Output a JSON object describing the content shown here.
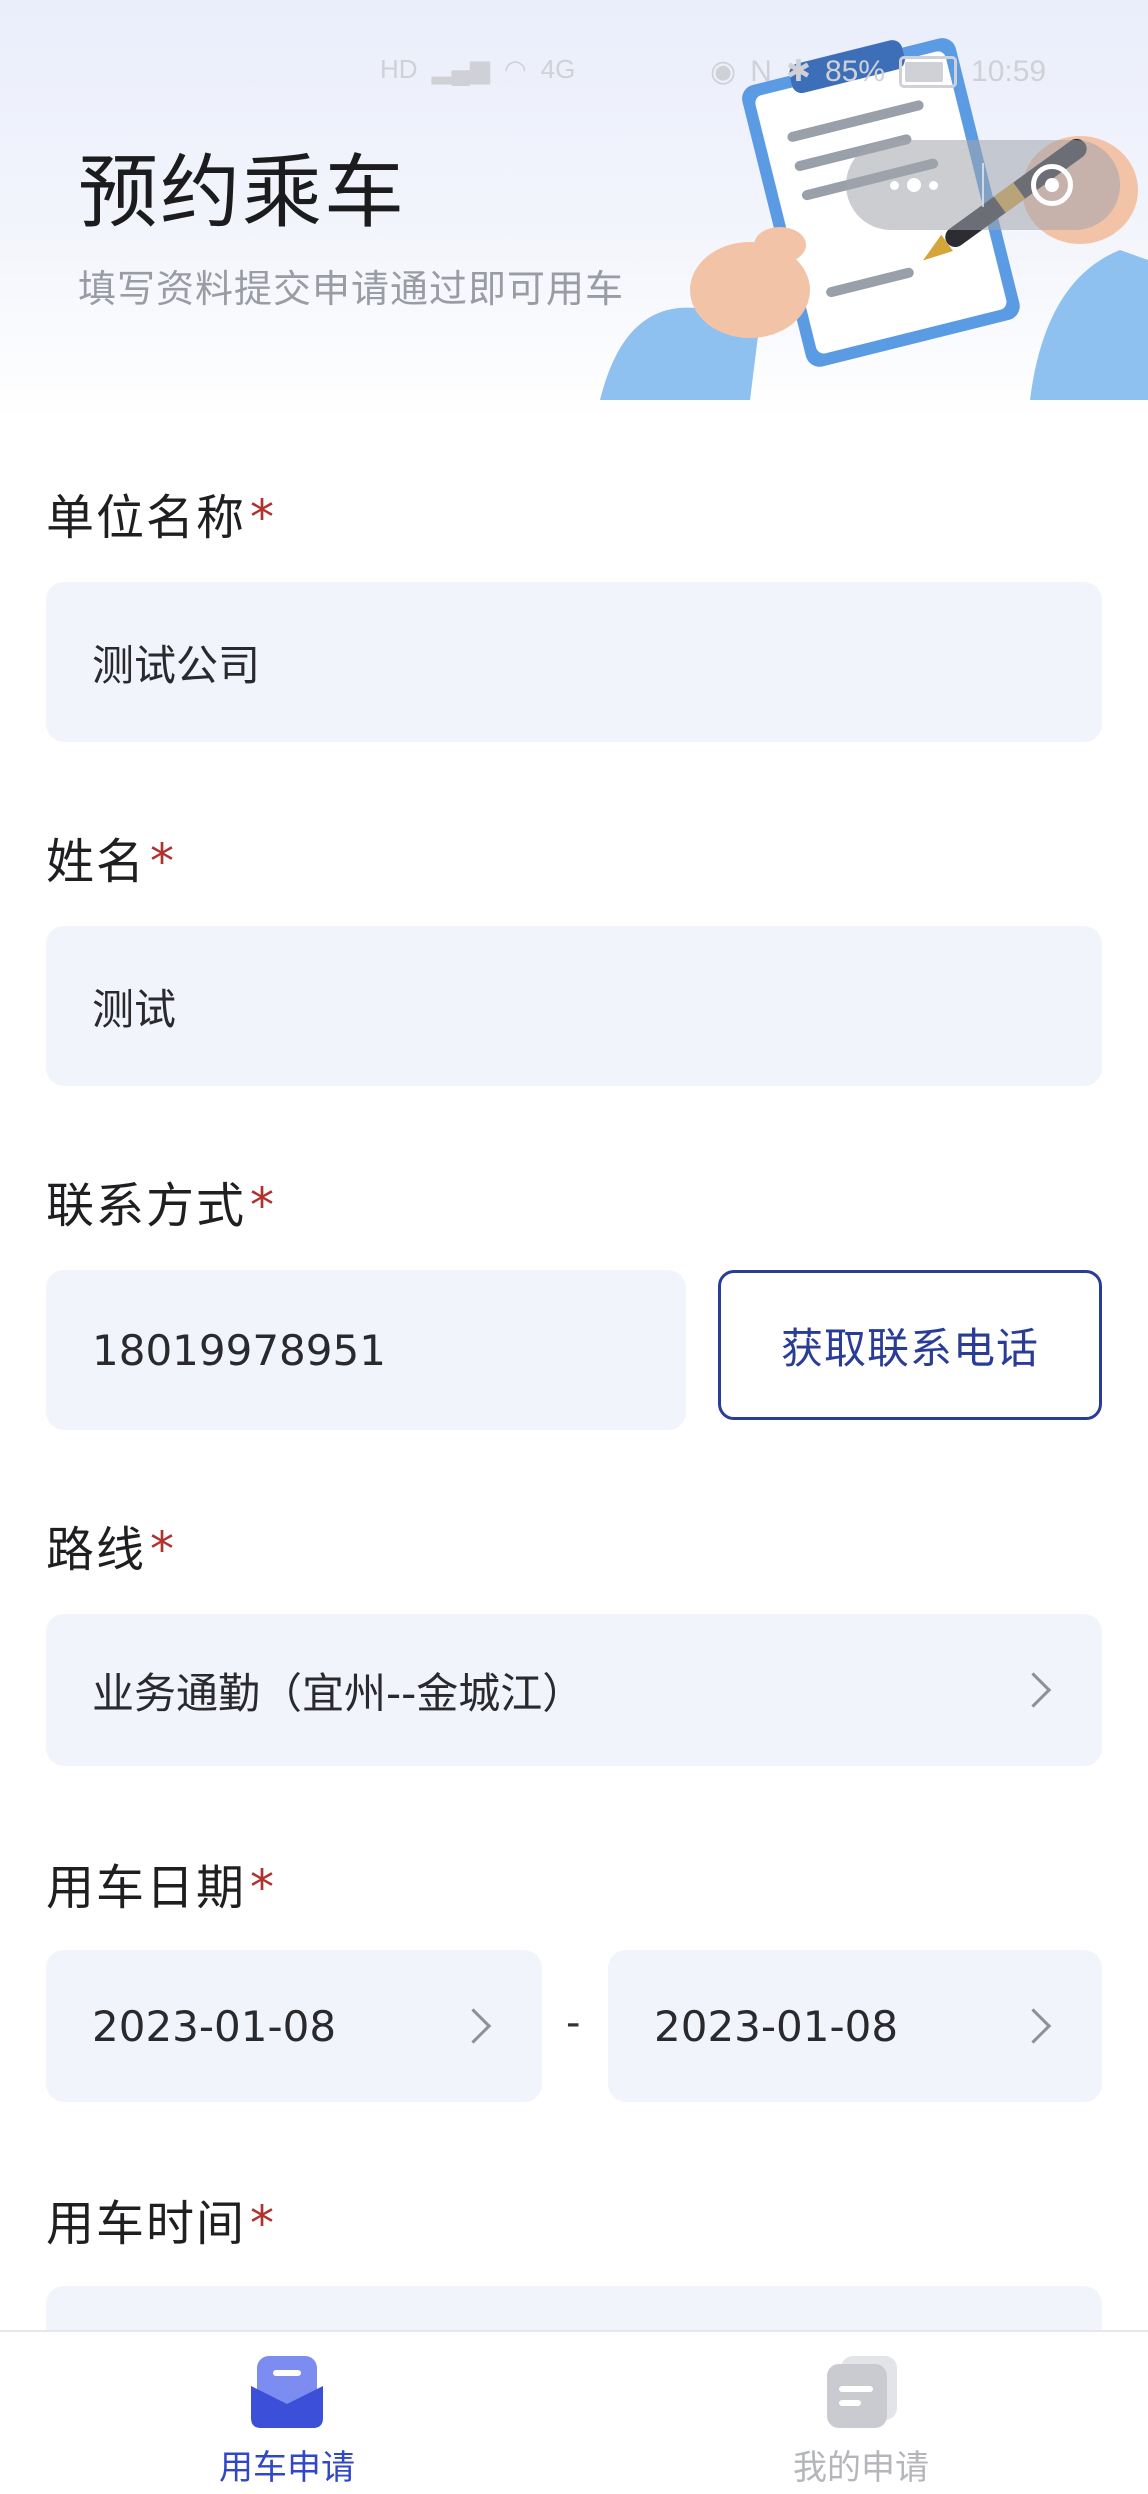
{
  "status_bar": {
    "left_text": "HD",
    "network": "4G",
    "battery_percent": "85%",
    "time": "10:59"
  },
  "header": {
    "title": "预约乘车",
    "subtitle": "填写资料提交申请通过即可用车"
  },
  "form": {
    "company": {
      "label": "单位名称",
      "required_mark": "*",
      "value": "测试公司"
    },
    "name": {
      "label": "姓名",
      "required_mark": "*",
      "value": "测试"
    },
    "contact": {
      "label": "联系方式",
      "required_mark": "*",
      "value": "18019978951",
      "button_label": "获取联系电话"
    },
    "route": {
      "label": "路线",
      "required_mark": "*",
      "value": "业务通勤（宜州--金城江）"
    },
    "date": {
      "label": "用车日期",
      "required_mark": "*",
      "start": "2023-01-08",
      "separator": "-",
      "end": "2023-01-08"
    },
    "time": {
      "label": "用车时间",
      "required_mark": "*",
      "value": ""
    }
  },
  "tabbar": {
    "tabs": [
      {
        "label": "用车申请",
        "active": true,
        "icon": "car-application-icon"
      },
      {
        "label": "我的申请",
        "active": false,
        "icon": "my-applications-icon"
      }
    ]
  },
  "colors": {
    "accent": "#3047c7",
    "required": "#b0312d",
    "field_bg": "#f1f4fa",
    "button_border": "#2a3d96"
  }
}
